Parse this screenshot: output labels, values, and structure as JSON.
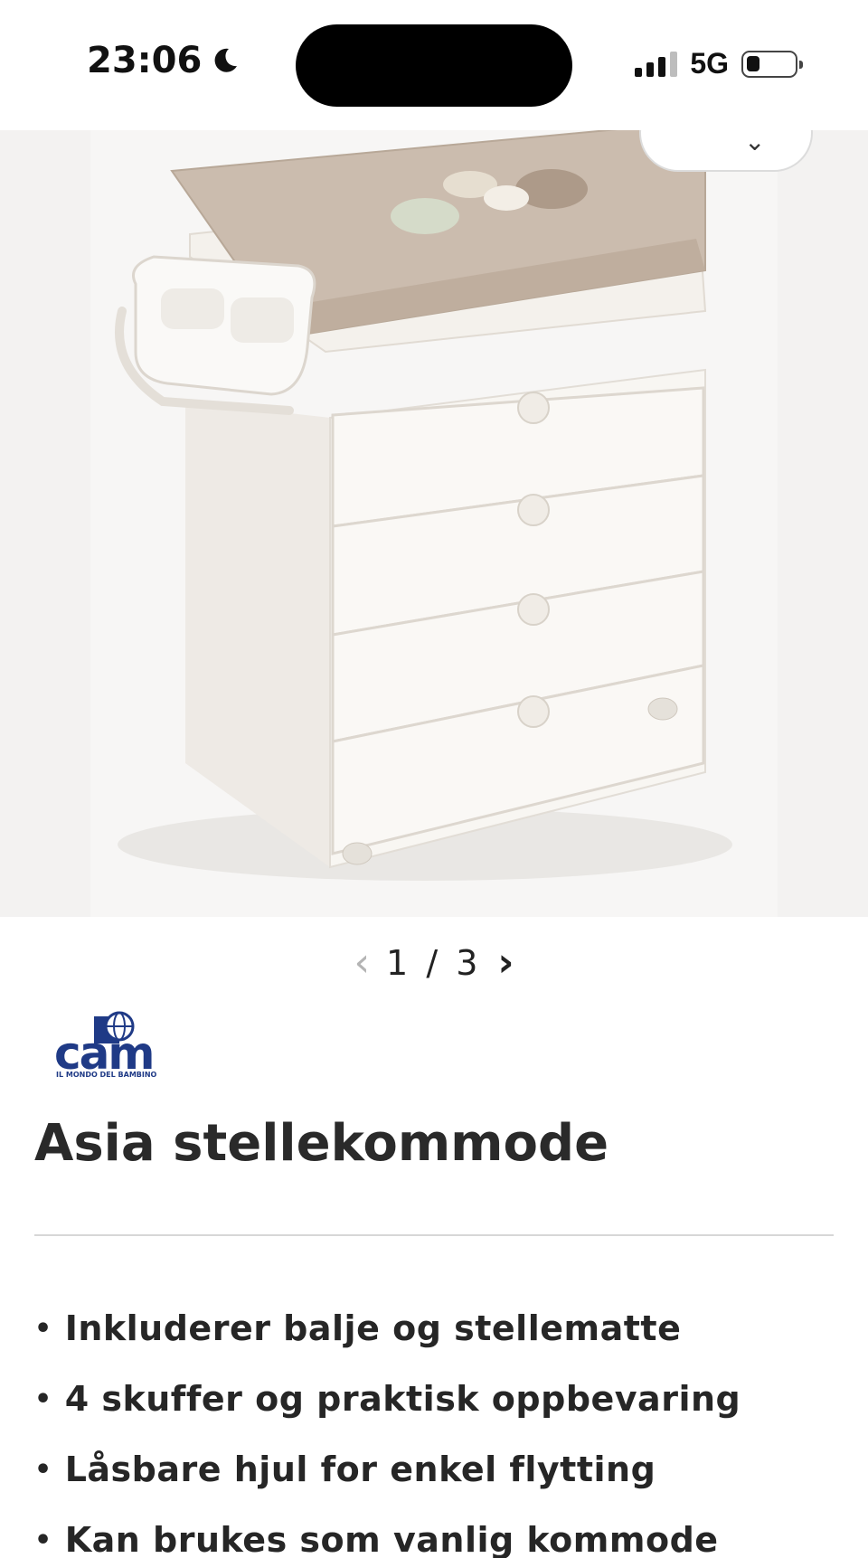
{
  "status_bar": {
    "time": "23:06",
    "network": "5G",
    "moon_icon": "moon-icon",
    "signal_icon": "cellular-signal-icon",
    "battery_icon": "battery-icon"
  },
  "gallery": {
    "image_alt": "Asia stellekommode",
    "pager_current": "1",
    "pager_separator": "/",
    "pager_total": "3",
    "prev_icon": "chevron-left-icon",
    "next_icon": "chevron-right-icon"
  },
  "brand": {
    "name": "cam",
    "tagline": "IL MONDO DEL BAMBINO"
  },
  "product": {
    "title": "Asia stellekommode",
    "features": [
      "Inkluderer balje og stellematte",
      "4 skuffer og praktisk oppbevaring",
      "Låsbare hjul for enkel flytting",
      "Kan brukes som vanlig kommode"
    ]
  },
  "colors": {
    "brand_blue": "#1f3a86",
    "mat_beige": "#cbbcae",
    "dresser_white": "#f8f6f2"
  }
}
